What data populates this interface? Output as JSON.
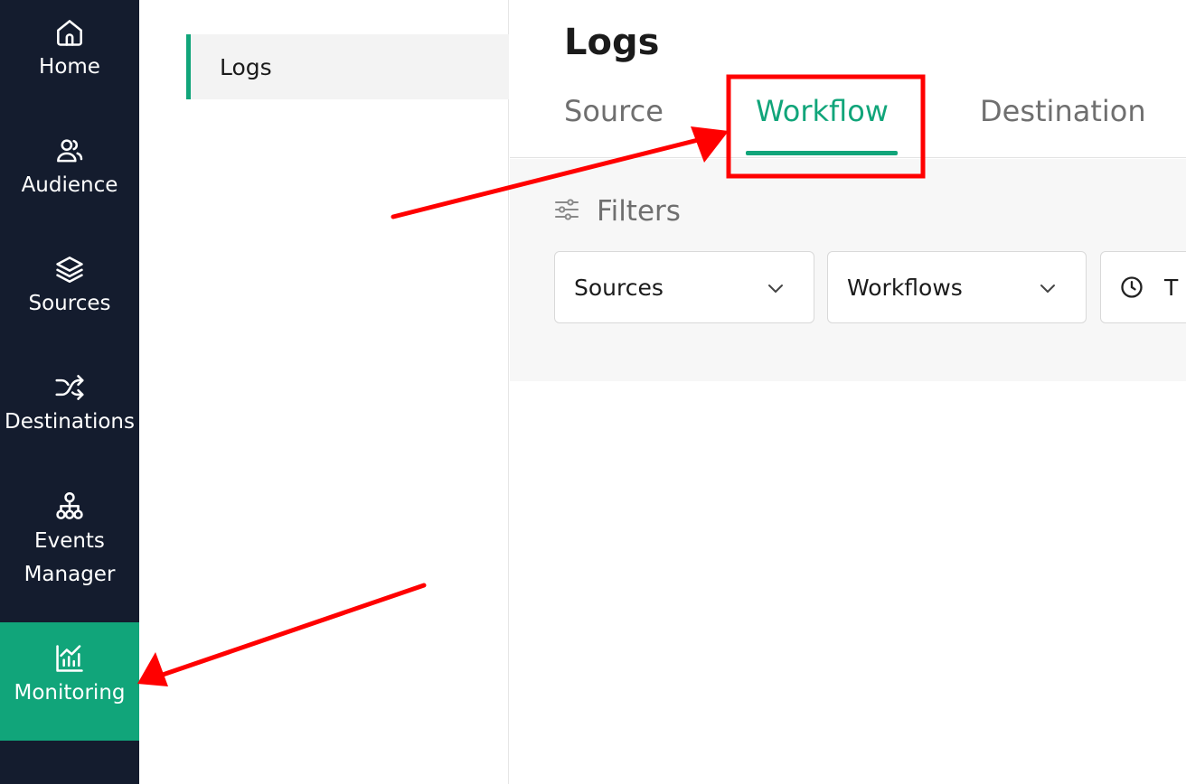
{
  "sidebar": {
    "items": [
      {
        "label": "Home",
        "icon": "home-icon"
      },
      {
        "label": "Audience",
        "icon": "users-icon"
      },
      {
        "label": "Sources",
        "icon": "layers-icon"
      },
      {
        "label": "Destinations",
        "icon": "shuffle-icon"
      },
      {
        "label": "Events\nManager",
        "icon": "hierarchy-icon"
      },
      {
        "label": "Monitoring",
        "icon": "chart-icon",
        "active": true
      }
    ]
  },
  "subnav": {
    "items": [
      {
        "label": "Logs",
        "active": true
      }
    ]
  },
  "main": {
    "title": "Logs",
    "tabs": [
      {
        "label": "Source"
      },
      {
        "label": "Workflow",
        "active": true
      },
      {
        "label": "Destination"
      }
    ],
    "filters": {
      "label": "Filters",
      "dropdowns": [
        {
          "label": "Sources"
        },
        {
          "label": "Workflows"
        },
        {
          "label": "T"
        }
      ]
    }
  },
  "colors": {
    "accent": "#11a57a",
    "sidebar_bg": "#141c2e",
    "annotation": "#ff0000"
  }
}
